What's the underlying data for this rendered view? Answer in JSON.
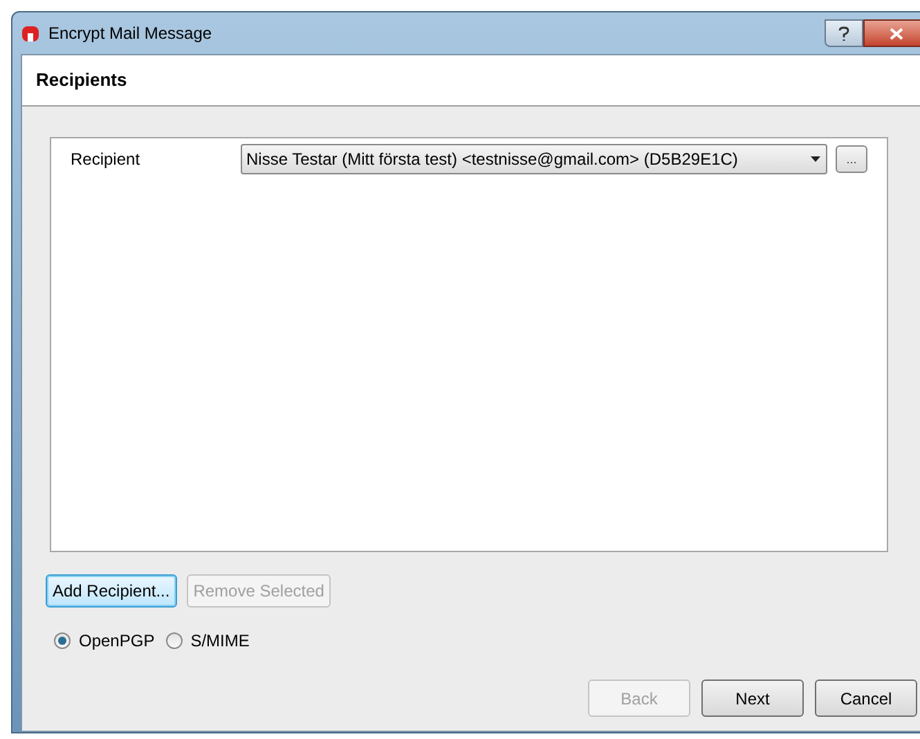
{
  "window": {
    "title": "Encrypt Mail Message"
  },
  "header": {
    "title": "Recipients"
  },
  "recipients": [
    {
      "label": "Recipient",
      "value": "Nisse Testar (Mitt första test) <testnisse@gmail.com> (D5B29E1C)",
      "more": "..."
    }
  ],
  "list_buttons": [
    {
      "label": "Add Recipient...",
      "disabled": false,
      "focused": true
    },
    {
      "label": "Remove Selected",
      "disabled": true,
      "focused": false
    }
  ],
  "protocols": [
    {
      "label": "OpenPGP",
      "selected": true
    },
    {
      "label": "S/MIME",
      "selected": false
    }
  ],
  "nav_buttons": [
    {
      "label": "Back",
      "disabled": true
    },
    {
      "label": "Next",
      "disabled": false
    },
    {
      "label": "Cancel",
      "disabled": false
    }
  ]
}
